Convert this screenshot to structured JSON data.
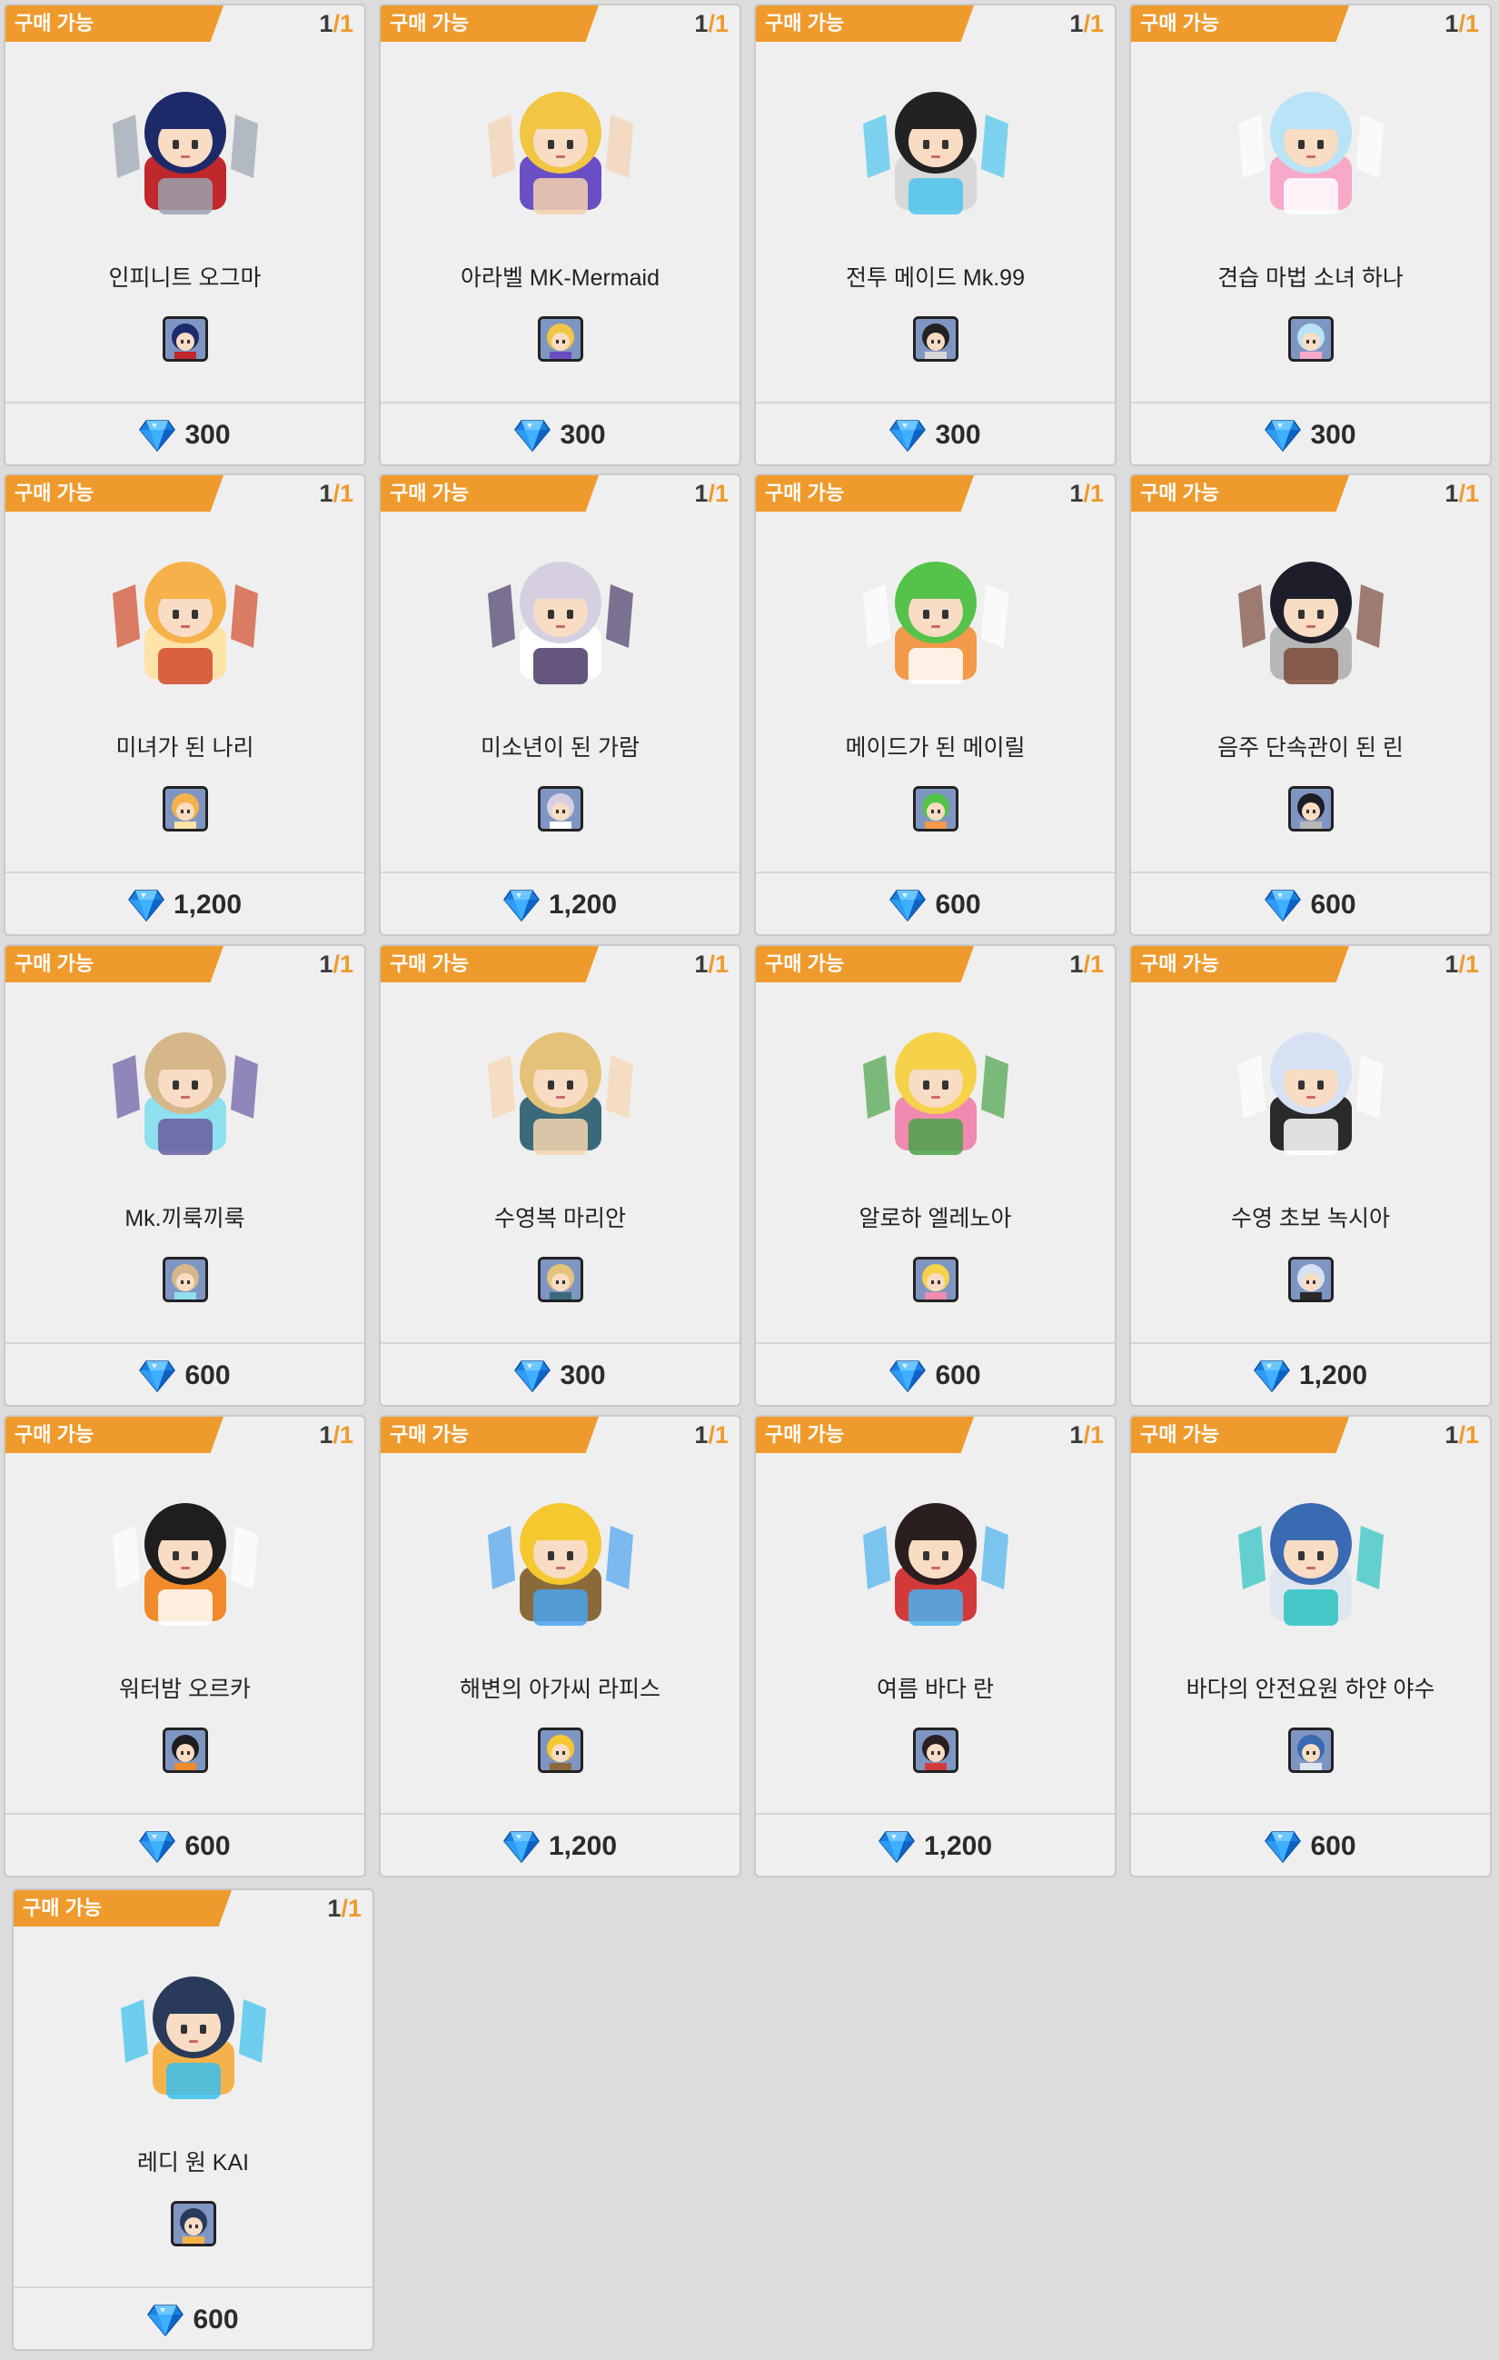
{
  "badge_label": "구매 가능",
  "colors": {
    "badge": "#ef9a2c",
    "card_bg": "#efefef",
    "page_bg": "#dcdcdc",
    "gem": "#1e90ff"
  },
  "currency_icon": "blue-diamond-gem-icon",
  "items": [
    {
      "name": "인피니트 오그마",
      "stock_current": "1",
      "stock_total": "1",
      "price": "300",
      "palette": [
        "#1c2a6a",
        "#c0282b",
        "#9aa2b0"
      ]
    },
    {
      "name": "아라벨 MK-Mermaid",
      "stock_current": "1",
      "stock_total": "1",
      "price": "300",
      "palette": [
        "#f2c542",
        "#6a4fc4",
        "#f4d2b0"
      ]
    },
    {
      "name": "전투 메이드 Mk.99",
      "stock_current": "1",
      "stock_total": "1",
      "price": "300",
      "palette": [
        "#222222",
        "#d8d8d8",
        "#4cc6ee"
      ]
    },
    {
      "name": "견습 마법 소녀 하나",
      "stock_current": "1",
      "stock_total": "1",
      "price": "300",
      "palette": [
        "#b9e3f6",
        "#f6a9c9",
        "#ffffff"
      ]
    },
    {
      "name": "미녀가 된 나리",
      "stock_current": "1",
      "stock_total": "1",
      "price": "1,200",
      "palette": [
        "#f6b14a",
        "#fde3a8",
        "#d24a2a"
      ]
    },
    {
      "name": "미소년이 된 가람",
      "stock_current": "1",
      "stock_total": "1",
      "price": "1,200",
      "palette": [
        "#d6cfe2",
        "#ffffff",
        "#4a3a66"
      ]
    },
    {
      "name": "메이드가 된 메이릴",
      "stock_current": "1",
      "stock_total": "1",
      "price": "600",
      "palette": [
        "#55c24a",
        "#f29a4a",
        "#ffffff"
      ]
    },
    {
      "name": "음주 단속관이 된 린",
      "stock_current": "1",
      "stock_total": "1",
      "price": "600",
      "palette": [
        "#1e1e2a",
        "#b7b7b7",
        "#7a4a3a"
      ]
    },
    {
      "name": "Mk.끼룩끼룩",
      "stock_current": "1",
      "stock_total": "1",
      "price": "600",
      "palette": [
        "#d6b78a",
        "#8ee0ee",
        "#6a5aa2"
      ]
    },
    {
      "name": "수영복 마리안",
      "stock_current": "1",
      "stock_total": "1",
      "price": "300",
      "palette": [
        "#e4c27a",
        "#3a6a7a",
        "#f6d6b0"
      ]
    },
    {
      "name": "알로하 엘레노아",
      "stock_current": "1",
      "stock_total": "1",
      "price": "600",
      "palette": [
        "#f6d24a",
        "#f08ab0",
        "#4aa24a"
      ]
    },
    {
      "name": "수영 초보 녹시아",
      "stock_current": "1",
      "stock_total": "1",
      "price": "1,200",
      "palette": [
        "#d6e2f4",
        "#2a2a2a",
        "#ffffff"
      ]
    },
    {
      "name": "워터밤 오르카",
      "stock_current": "1",
      "stock_total": "1",
      "price": "600",
      "palette": [
        "#1e1e1e",
        "#f08a2a",
        "#ffffff"
      ]
    },
    {
      "name": "해변의 아가씨 라피스",
      "stock_current": "1",
      "stock_total": "1",
      "price": "1,200",
      "palette": [
        "#f6c830",
        "#8a6a3a",
        "#4aa2ee"
      ]
    },
    {
      "name": "여름 바다 란",
      "stock_current": "1",
      "stock_total": "1",
      "price": "1,200",
      "palette": [
        "#2a1e1e",
        "#d23a3a",
        "#4ab2ee"
      ]
    },
    {
      "name": "바다의 안전요원 하얀 야수",
      "stock_current": "1",
      "stock_total": "1",
      "price": "600",
      "palette": [
        "#3a6ab2",
        "#e0e6f0",
        "#2ac2c2"
      ]
    },
    {
      "name": "레디 원 KAI",
      "stock_current": "1",
      "stock_total": "1",
      "price": "600",
      "palette": [
        "#2a3a5a",
        "#f6b24a",
        "#38c0ee"
      ]
    }
  ]
}
